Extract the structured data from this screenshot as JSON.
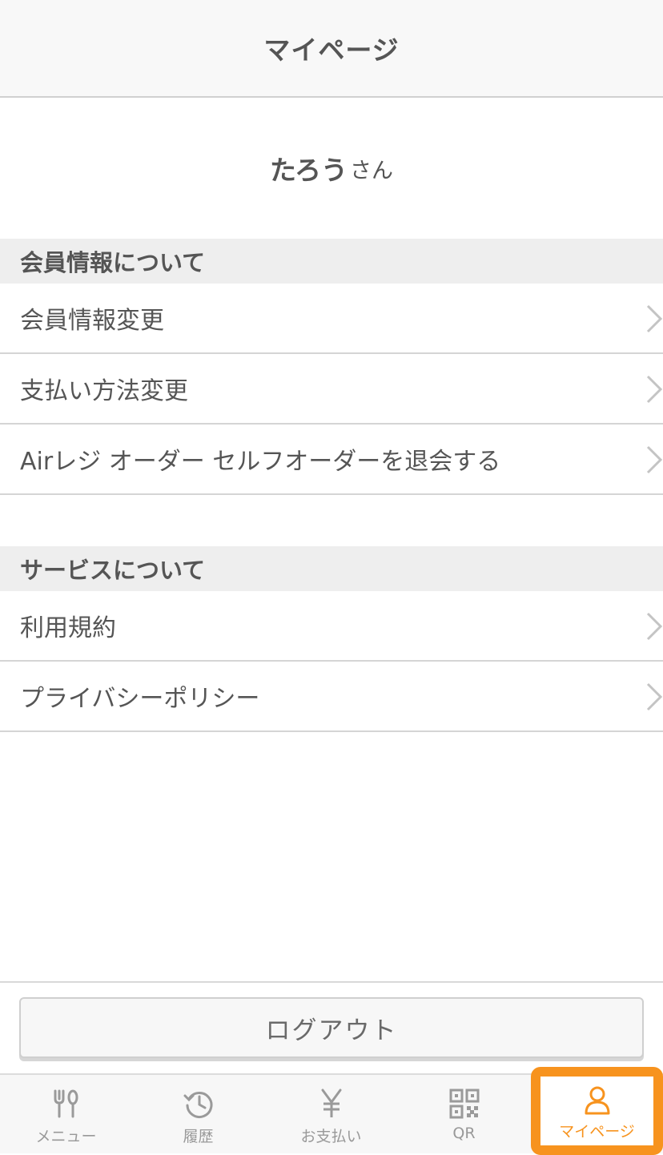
{
  "header": {
    "title": "マイページ"
  },
  "greeting": {
    "name": "たろう",
    "suffix": "さん"
  },
  "sections": [
    {
      "title": "会員情報について",
      "items": [
        {
          "label": "会員情報変更"
        },
        {
          "label": "支払い方法変更"
        },
        {
          "label": "Airレジ オーダー セルフオーダーを退会する"
        }
      ]
    },
    {
      "title": "サービスについて",
      "items": [
        {
          "label": "利用規約"
        },
        {
          "label": "プライバシーポリシー"
        }
      ]
    }
  ],
  "logout": {
    "label": "ログアウト"
  },
  "tabbar": {
    "tabs": [
      {
        "label": "メニュー",
        "icon": "fork-spoon-icon"
      },
      {
        "label": "履歴",
        "icon": "history-icon"
      },
      {
        "label": "お支払い",
        "icon": "yen-icon"
      },
      {
        "label": "QR",
        "icon": "qr-code-icon"
      },
      {
        "label": "マイページ",
        "icon": "user-icon",
        "active": true
      }
    ],
    "active_color": "#f7931e",
    "inactive_color": "#999999"
  }
}
